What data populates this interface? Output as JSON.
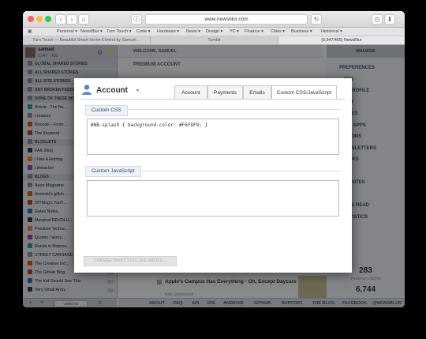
{
  "browser": {
    "url": "www.newsblur.com",
    "bookmarks": [
      "Personal ▾",
      "NewsBlur ▾",
      "Turn Touch ▾",
      "Code ▾",
      "Hardware ▾",
      "News ▾",
      "Design ▾",
      "YC ▾",
      "Finance ▾",
      "Cities ▾",
      "Business ▾",
      "Historical ▾"
    ],
    "tabs": [
      "Turn Touch — Beautiful Smart Home Control by Samuel…",
      "Tumblr",
      "(6,947/405) NewsBlur"
    ]
  },
  "sidebar": {
    "username": "samuel",
    "stats": "6,947 · 405",
    "items": [
      {
        "label": "GLOBAL SHARED STORIES",
        "type": "folder"
      },
      {
        "label": "ALL SHARED STORIES",
        "type": "folder"
      },
      {
        "label": "ALL SITE STORIES",
        "type": "folder"
      },
      {
        "label": "ANY BROKEN FEEDS",
        "type": "folder"
      },
      {
        "label": "SOME OF THESE WO…",
        "type": "folder"
      },
      {
        "label": "Article - The Ne…",
        "type": "feed"
      },
      {
        "label": "creatses",
        "type": "feed"
      },
      {
        "label": "Recode – From…",
        "type": "feed"
      },
      {
        "label": "The Keyword",
        "type": "feed"
      },
      {
        "label": "BLOGLETS",
        "type": "folder"
      },
      {
        "label": "FAIL Blog",
        "type": "feed"
      },
      {
        "label": "I Has A Hotdog",
        "type": "feed"
      },
      {
        "label": "Lifehacker",
        "type": "feed"
      },
      {
        "label": "BLOGS",
        "type": "folder"
      },
      {
        "label": "Aeon Magazine",
        "type": "feed"
      },
      {
        "label": "dosiecki's giftsh…",
        "type": "feed"
      },
      {
        "label": "DIYblog's YouT…",
        "type": "feed"
      },
      {
        "label": "Gates Notes",
        "type": "feed"
      },
      {
        "label": "Marginal REVOLU…",
        "type": "feed"
      },
      {
        "label": "Primitive Techno…",
        "type": "feed"
      },
      {
        "label": "Quotes / worry…",
        "type": "feed"
      },
      {
        "label": "Rands in Repose",
        "type": "feed"
      },
      {
        "label": "STREET CARNAGE",
        "type": "feed"
      },
      {
        "label": "The Creative Ind…",
        "type": "feed"
      },
      {
        "label": "The Github Blog",
        "type": "feed"
      },
      {
        "label": "The Kid Should See This",
        "type": "feed"
      },
      {
        "label": "Very Small Array",
        "type": "feed"
      }
    ],
    "footer": "UNREAD"
  },
  "main": {
    "welcome": "WELCOME, SAMUEL",
    "premium": "PREMIUM ACCOUNT",
    "story_title": "Apple's Campus Has Everything - Oh, Except Daycare",
    "story_meta": "Kelli Spearwood",
    "stat1": "283",
    "stat1_label": "PREMIUM USERS",
    "stat2": "6,744"
  },
  "manage": {
    "title": "MANAGE",
    "items": [
      "PREFERENCES",
      "…ERS",
      "…G PROFILE",
      "…UNT",
      "…SITES",
      "…S & APPS",
      "…ATIONS",
      "…EWSLETTERS",
      "…RICKS",
      "…RD",
      "…ZE SITES",
      "…ES",
      "…L AS READ",
      "…TATISTICS"
    ]
  },
  "footer_links": [
    "ABOUT",
    "FAQ",
    "API",
    "IOS",
    "ANDROID",
    "GITHUB",
    "SUPPORT",
    "THE BLOG",
    "FACEBOOK",
    "@NEWSBLUR"
  ],
  "modal": {
    "title": "Account",
    "tabs": [
      "Account",
      "Payments",
      "Emails",
      "Custom CSS/JavaScript"
    ],
    "active_tab": "Custom CSS/JavaScript",
    "css_label": "Custom CSS",
    "css_value": "#NB-splash { background-color: #F6F8F9; }",
    "js_label": "Custom JavaScript",
    "js_value": "",
    "save_label": "CHANGE WHAT YOU LIKE ABOVE..."
  }
}
